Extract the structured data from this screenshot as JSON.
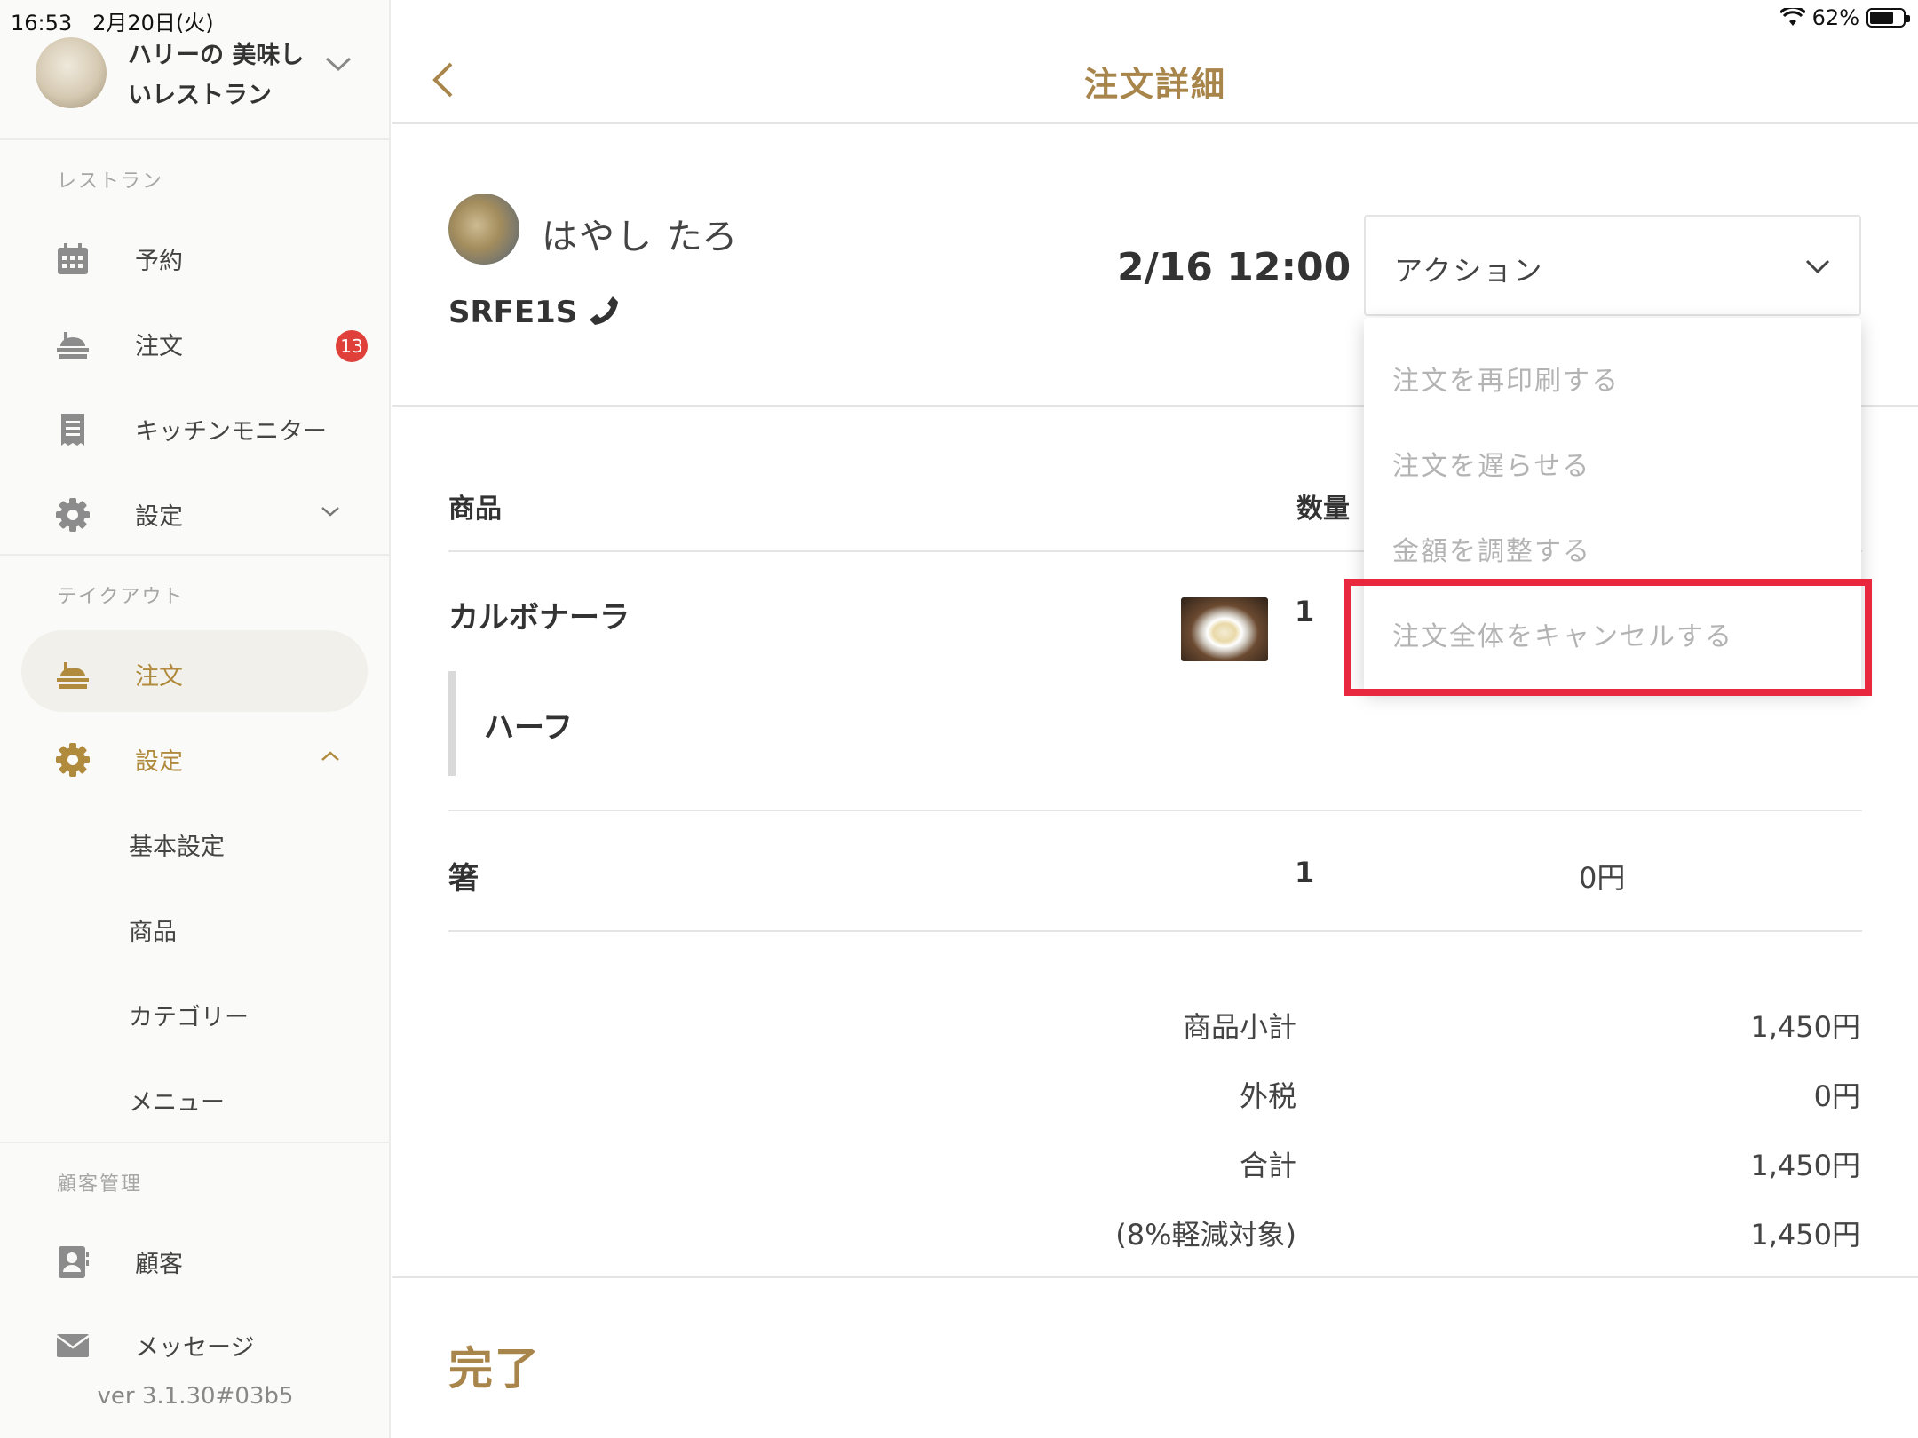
{
  "status_bar": {
    "time": "16:53",
    "date": "2月20日(火)",
    "battery": "62%"
  },
  "sidebar": {
    "store_name": "ハリーの 美味しいレストラン",
    "sections": {
      "restaurant": "レストラン",
      "takeout": "テイクアウト",
      "customer_mgmt": "顧客管理"
    },
    "restaurant_items": [
      {
        "label": "予約",
        "icon": "calendar-icon"
      },
      {
        "label": "注文",
        "icon": "food-tray-icon",
        "badge": "13"
      },
      {
        "label": "キッチンモニター",
        "icon": "receipt-icon"
      },
      {
        "label": "設定",
        "icon": "gear-icon"
      }
    ],
    "takeout_items": [
      {
        "label": "注文",
        "icon": "food-tray-icon"
      },
      {
        "label": "設定",
        "icon": "gear-icon"
      }
    ],
    "takeout_settings_sub": [
      "基本設定",
      "商品",
      "カテゴリー",
      "メニュー"
    ],
    "customer_items": [
      {
        "label": "顧客",
        "icon": "contact-card-icon"
      },
      {
        "label": "メッセージ",
        "icon": "envelope-icon"
      }
    ],
    "version": "ver 3.1.30#03b5"
  },
  "header": {
    "title": "注文詳細"
  },
  "order": {
    "customer_name": "はやし たろ",
    "code": "SRFE1S",
    "time": "2/16 12:00",
    "action_label": "アクション",
    "table_headers": {
      "product": "商品",
      "quantity": "数量"
    },
    "items": [
      {
        "name": "カルボナーラ",
        "qty": "1",
        "option": "ハーフ"
      },
      {
        "name": "箸",
        "qty": "1",
        "price": "0円"
      }
    ],
    "summary": [
      {
        "label": "商品小計",
        "value": "1,450円"
      },
      {
        "label": "外税",
        "value": "0円"
      },
      {
        "label": "合計",
        "value": "1,450円"
      },
      {
        "label": "(8%軽減対象)",
        "value": "1,450円"
      }
    ],
    "status": "完了"
  },
  "action_menu": {
    "items": [
      "注文を再印刷する",
      "注文を遅らせる",
      "金額を調整する",
      "注文全体をキャンセルする"
    ],
    "highlighted_index": 3
  },
  "colors": {
    "accent": "#a8854a",
    "badge": "#e0403a",
    "highlight": "#e8283f"
  }
}
